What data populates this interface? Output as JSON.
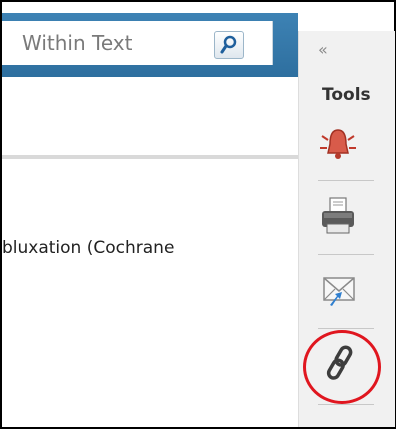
{
  "search": {
    "placeholder": "Within Text",
    "button_icon": "search-icon"
  },
  "content": {
    "visible_text": "bluxation (Cochrane"
  },
  "tools": {
    "collapse_glyph": "«",
    "title": "Tools",
    "items": [
      {
        "name": "alert-icon"
      },
      {
        "name": "print-icon"
      },
      {
        "name": "email-icon"
      },
      {
        "name": "link-icon"
      }
    ]
  },
  "colors": {
    "header_blue": "#2e6f9f",
    "highlight_red": "#e0161f"
  }
}
